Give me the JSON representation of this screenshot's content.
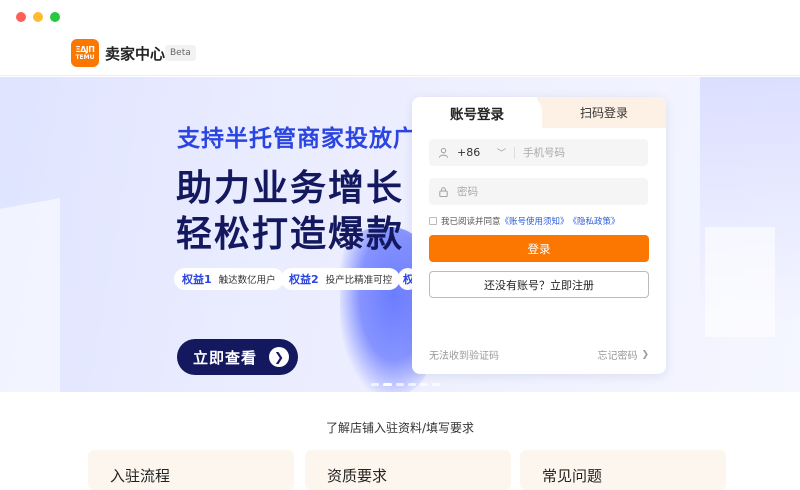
{
  "header": {
    "logo_line1": "ΞΔJΠ",
    "logo_line2": "TEMU",
    "title": "卖家中心",
    "badge": "Beta"
  },
  "hero": {
    "subtitle": "支持半托管商家投放广",
    "line1": "助力业务增长",
    "line2": "轻松打造爆款",
    "perks": [
      {
        "tag": "权益1",
        "text": "触达数亿用户"
      },
      {
        "tag": "权益2",
        "text": "投产比精准可控"
      },
      {
        "tag": "权"
      }
    ],
    "cta_label": "立即查看",
    "cta_icon": "arrow-right-icon",
    "slide_count": 6,
    "active_slide": 1
  },
  "login": {
    "tab_account": "账号登录",
    "tab_qr": "扫码登录",
    "country_code": "+86",
    "phone_placeholder": "手机号码",
    "password_placeholder": "密码",
    "agree_text": "我已阅读并同意",
    "agree_link1": "《账号使用须知》",
    "agree_link2": "《隐私政策》",
    "login_button": "登录",
    "register_button": "还没有账号？立即注册",
    "no_code": "无法收到验证码",
    "forgot_password": "忘记密码",
    "accent_color": "#fb7701"
  },
  "info": {
    "section_title": "了解店铺入驻资料/填写要求",
    "cards": [
      {
        "label": "入驻流程"
      },
      {
        "label": "资质要求"
      },
      {
        "label": "常见问题"
      }
    ]
  }
}
